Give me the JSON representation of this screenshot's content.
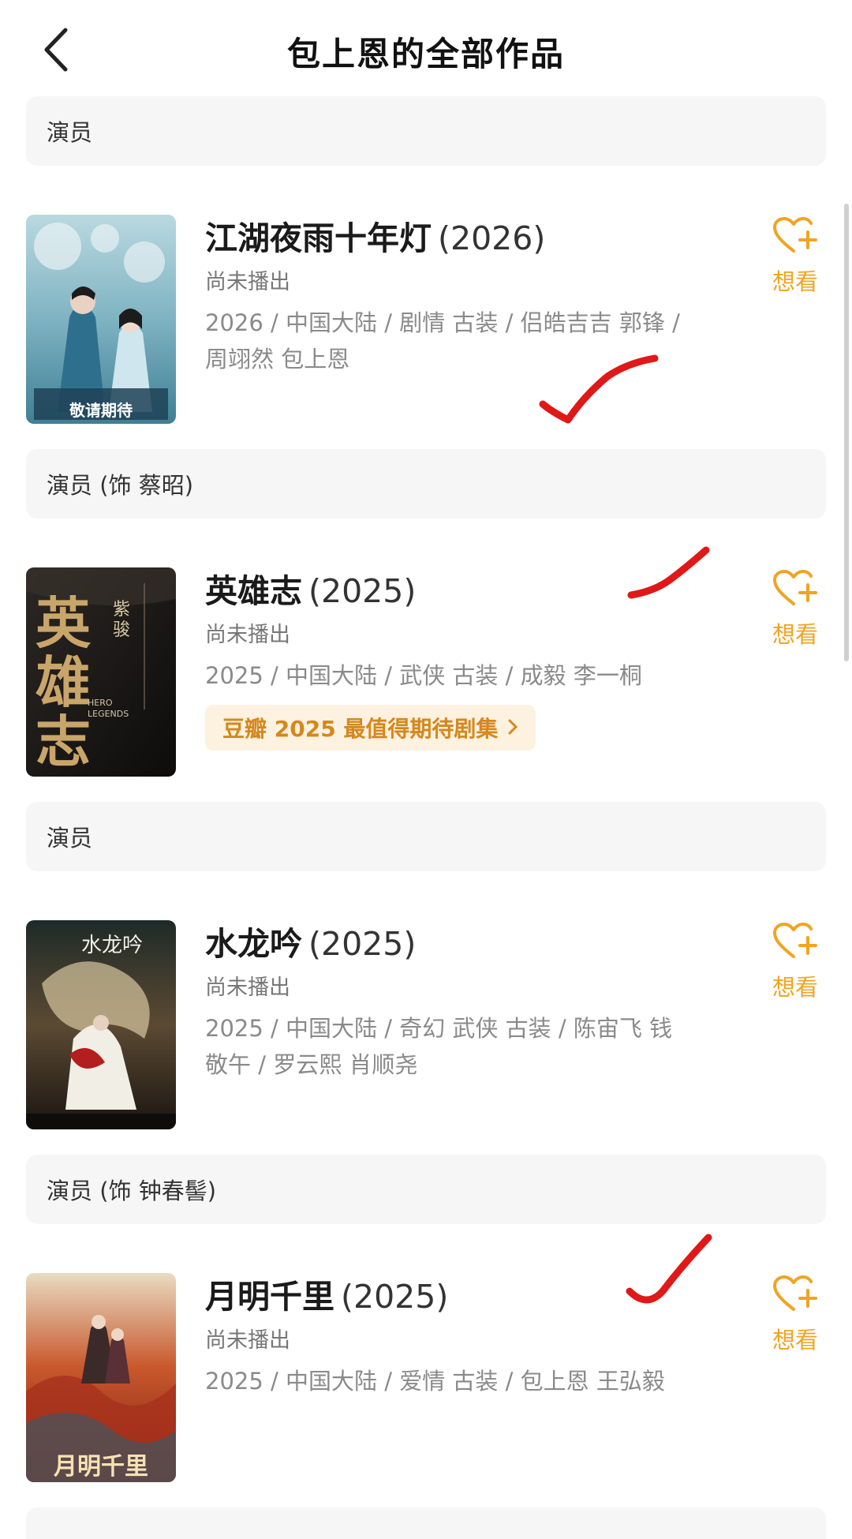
{
  "header": {
    "title": "包上恩的全部作品"
  },
  "theme": {
    "accent": "#f0a422",
    "award_bg": "#fdf1df",
    "award_text": "#d4881d",
    "check_mark": "#e01818"
  },
  "icons": {
    "back": "chevron-left-icon",
    "want": "heart-plus-icon",
    "award_arrow": "chevron-right-icon",
    "annotation": "red-checkmark"
  },
  "works": [
    {
      "role": "演员",
      "title": "江湖夜雨十年灯",
      "year": "(2026)",
      "status": "尚未播出",
      "meta": "2026 / 中国大陆 / 剧情 古装 / 侣皓吉吉 郭锋 / 周翊然 包上恩",
      "poster_text": "敬请期待",
      "want_label": "想看",
      "award": "",
      "checked": true
    },
    {
      "role": "演员 (饰 蔡昭)",
      "title": "英雄志",
      "year": "(2025)",
      "status": "尚未播出",
      "meta": "2025 / 中国大陆 / 武侠 古装 / 成毅 李一桐",
      "poster_text": "英雄志",
      "poster_subtext": "HERO LEGENDS",
      "want_label": "想看",
      "award": "豆瓣 2025 最值得期待剧集",
      "checked": true
    },
    {
      "role": "演员",
      "title": "水龙吟",
      "year": "(2025)",
      "status": "尚未播出",
      "meta": "2025 / 中国大陆 / 奇幻 武侠 古装 / 陈宙飞 钱敬午 / 罗云熙 肖顺尧",
      "poster_text": "水龙吟",
      "want_label": "想看",
      "award": "",
      "checked": false
    },
    {
      "role": "演员 (饰 钟春髻)",
      "title": "月明千里",
      "year": "(2025)",
      "status": "尚未播出",
      "meta": "2025 / 中国大陆 / 爱情 古装 / 包上恩 王弘毅",
      "poster_text": "月明千里",
      "want_label": "想看",
      "award": "",
      "checked": true
    }
  ]
}
